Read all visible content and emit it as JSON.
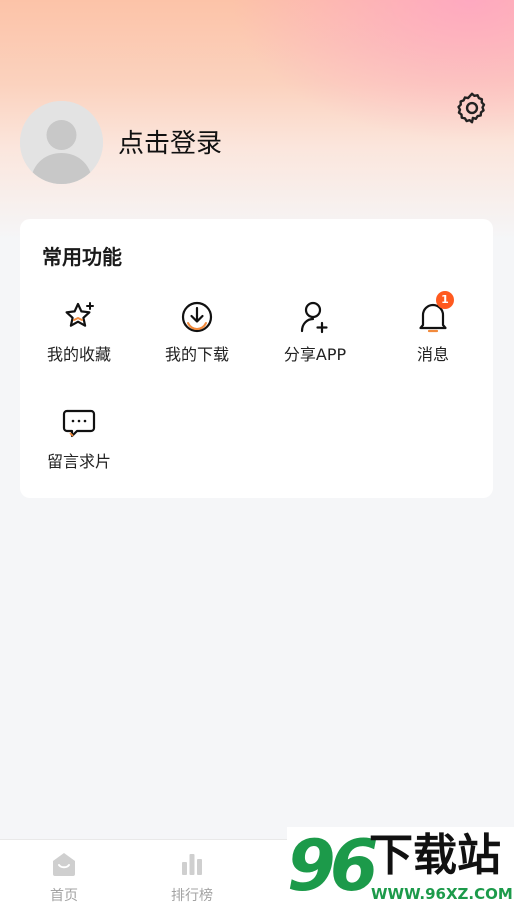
{
  "header": {
    "login_label": "点击登录"
  },
  "functions": {
    "title": "常用功能",
    "items": [
      {
        "label": "我的收藏",
        "icon": "star-icon"
      },
      {
        "label": "我的下载",
        "icon": "download-icon"
      },
      {
        "label": "分享APP",
        "icon": "user-add-icon"
      },
      {
        "label": "消息",
        "icon": "bell-icon",
        "badge": "1"
      },
      {
        "label": "留言求片",
        "icon": "chat-icon"
      }
    ]
  },
  "tabbar": {
    "items": [
      {
        "label": "首页",
        "icon": "home-icon"
      },
      {
        "label": "排行榜",
        "icon": "bar-chart-icon"
      }
    ]
  },
  "watermark": {
    "number": "96",
    "text": "下载站",
    "url": "WWW.96XZ.COM"
  },
  "colors": {
    "accent": "#f28a3c",
    "badge": "#ff5a1f",
    "watermark_green": "#1c9a4a"
  }
}
